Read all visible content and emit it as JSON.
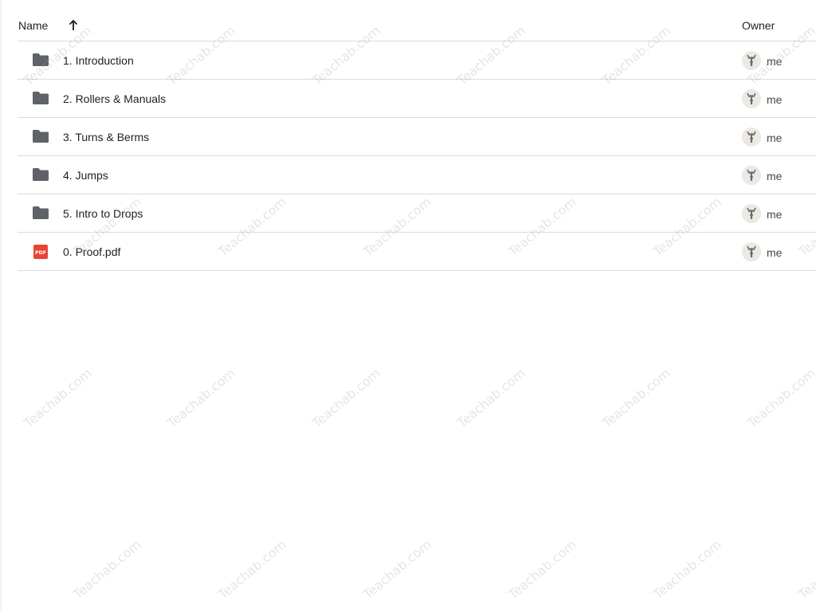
{
  "header": {
    "name_label": "Name",
    "owner_label": "Owner",
    "sort_icon": "arrow-up-icon"
  },
  "files": [
    {
      "type": "folder",
      "icon": "folder-icon",
      "name": "1. Introduction",
      "owner": "me"
    },
    {
      "type": "folder",
      "icon": "folder-icon",
      "name": "2. Rollers & Manuals",
      "owner": "me"
    },
    {
      "type": "folder",
      "icon": "folder-icon",
      "name": "3. Turns & Berms",
      "owner": "me"
    },
    {
      "type": "folder",
      "icon": "folder-icon",
      "name": "4. Jumps",
      "owner": "me"
    },
    {
      "type": "folder",
      "icon": "folder-icon",
      "name": "5. Intro to Drops",
      "owner": "me"
    },
    {
      "type": "pdf",
      "icon": "pdf-icon",
      "icon_label": "PDF",
      "name": "0. Proof.pdf",
      "owner": "me"
    }
  ],
  "watermark": {
    "text": "Teachab.com"
  },
  "colors": {
    "folder": "#5f6368",
    "pdf": "#ea4335",
    "divider": "#dadce0"
  }
}
